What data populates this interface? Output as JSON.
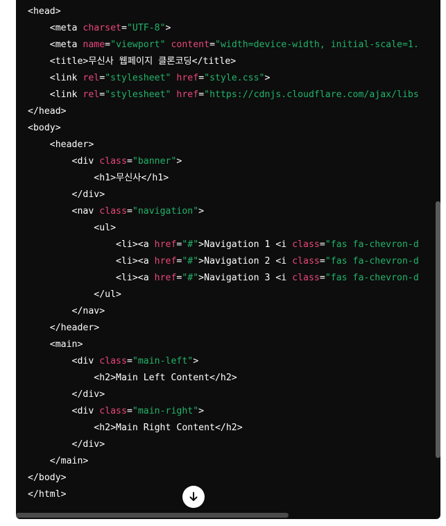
{
  "code_lines": [
    {
      "indent": "",
      "tokens": [
        {
          "t": "plain",
          "s": "<head>"
        }
      ]
    },
    {
      "indent": "    ",
      "tokens": [
        {
          "t": "plain",
          "s": "<meta "
        },
        {
          "t": "attr",
          "s": "charset"
        },
        {
          "t": "plain",
          "s": "="
        },
        {
          "t": "str",
          "s": "\"UTF-8\""
        },
        {
          "t": "plain",
          "s": ">"
        }
      ]
    },
    {
      "indent": "    ",
      "tokens": [
        {
          "t": "plain",
          "s": "<meta "
        },
        {
          "t": "attr",
          "s": "name"
        },
        {
          "t": "plain",
          "s": "="
        },
        {
          "t": "str",
          "s": "\"viewport\""
        },
        {
          "t": "plain",
          "s": " "
        },
        {
          "t": "attr",
          "s": "content"
        },
        {
          "t": "plain",
          "s": "="
        },
        {
          "t": "str",
          "s": "\"width=device-width, initial-scale=1."
        }
      ]
    },
    {
      "indent": "    ",
      "tokens": [
        {
          "t": "plain",
          "s": "<title>무신사 웹페이지 클론코딩</title>"
        }
      ]
    },
    {
      "indent": "    ",
      "tokens": [
        {
          "t": "plain",
          "s": "<link "
        },
        {
          "t": "attr",
          "s": "rel"
        },
        {
          "t": "plain",
          "s": "="
        },
        {
          "t": "str",
          "s": "\"stylesheet\""
        },
        {
          "t": "plain",
          "s": " "
        },
        {
          "t": "attr",
          "s": "href"
        },
        {
          "t": "plain",
          "s": "="
        },
        {
          "t": "str",
          "s": "\"style.css\""
        },
        {
          "t": "plain",
          "s": ">"
        }
      ]
    },
    {
      "indent": "    ",
      "tokens": [
        {
          "t": "plain",
          "s": "<link "
        },
        {
          "t": "attr",
          "s": "rel"
        },
        {
          "t": "plain",
          "s": "="
        },
        {
          "t": "str",
          "s": "\"stylesheet\""
        },
        {
          "t": "plain",
          "s": " "
        },
        {
          "t": "attr",
          "s": "href"
        },
        {
          "t": "plain",
          "s": "="
        },
        {
          "t": "str",
          "s": "\"https://cdnjs.cloudflare.com/ajax/libs"
        }
      ]
    },
    {
      "indent": "",
      "tokens": [
        {
          "t": "plain",
          "s": "</head>"
        }
      ]
    },
    {
      "indent": "",
      "tokens": [
        {
          "t": "plain",
          "s": "<body>"
        }
      ]
    },
    {
      "indent": "    ",
      "tokens": [
        {
          "t": "plain",
          "s": "<header>"
        }
      ]
    },
    {
      "indent": "        ",
      "tokens": [
        {
          "t": "plain",
          "s": "<div "
        },
        {
          "t": "attr",
          "s": "class"
        },
        {
          "t": "plain",
          "s": "="
        },
        {
          "t": "str",
          "s": "\"banner\""
        },
        {
          "t": "plain",
          "s": ">"
        }
      ]
    },
    {
      "indent": "            ",
      "tokens": [
        {
          "t": "plain",
          "s": "<h1>무신사</h1>"
        }
      ]
    },
    {
      "indent": "        ",
      "tokens": [
        {
          "t": "plain",
          "s": "</div>"
        }
      ]
    },
    {
      "indent": "        ",
      "tokens": [
        {
          "t": "plain",
          "s": "<nav "
        },
        {
          "t": "attr",
          "s": "class"
        },
        {
          "t": "plain",
          "s": "="
        },
        {
          "t": "str",
          "s": "\"navigation\""
        },
        {
          "t": "plain",
          "s": ">"
        }
      ]
    },
    {
      "indent": "            ",
      "tokens": [
        {
          "t": "plain",
          "s": "<ul>"
        }
      ]
    },
    {
      "indent": "                ",
      "tokens": [
        {
          "t": "plain",
          "s": "<li><a "
        },
        {
          "t": "attr",
          "s": "href"
        },
        {
          "t": "plain",
          "s": "="
        },
        {
          "t": "str",
          "s": "\"#\""
        },
        {
          "t": "plain",
          "s": ">Navigation 1 <i "
        },
        {
          "t": "attr",
          "s": "class"
        },
        {
          "t": "plain",
          "s": "="
        },
        {
          "t": "str",
          "s": "\"fas fa-chevron-d"
        }
      ]
    },
    {
      "indent": "                ",
      "tokens": [
        {
          "t": "plain",
          "s": "<li><a "
        },
        {
          "t": "attr",
          "s": "href"
        },
        {
          "t": "plain",
          "s": "="
        },
        {
          "t": "str",
          "s": "\"#\""
        },
        {
          "t": "plain",
          "s": ">Navigation 2 <i "
        },
        {
          "t": "attr",
          "s": "class"
        },
        {
          "t": "plain",
          "s": "="
        },
        {
          "t": "str",
          "s": "\"fas fa-chevron-d"
        }
      ]
    },
    {
      "indent": "                ",
      "tokens": [
        {
          "t": "plain",
          "s": "<li><a "
        },
        {
          "t": "attr",
          "s": "href"
        },
        {
          "t": "plain",
          "s": "="
        },
        {
          "t": "str",
          "s": "\"#\""
        },
        {
          "t": "plain",
          "s": ">Navigation 3 <i "
        },
        {
          "t": "attr",
          "s": "class"
        },
        {
          "t": "plain",
          "s": "="
        },
        {
          "t": "str",
          "s": "\"fas fa-chevron-d"
        }
      ]
    },
    {
      "indent": "            ",
      "tokens": [
        {
          "t": "plain",
          "s": "</ul>"
        }
      ]
    },
    {
      "indent": "        ",
      "tokens": [
        {
          "t": "plain",
          "s": "</nav>"
        }
      ]
    },
    {
      "indent": "    ",
      "tokens": [
        {
          "t": "plain",
          "s": "</header>"
        }
      ]
    },
    {
      "indent": "    ",
      "tokens": [
        {
          "t": "plain",
          "s": "<main>"
        }
      ]
    },
    {
      "indent": "        ",
      "tokens": [
        {
          "t": "plain",
          "s": "<div "
        },
        {
          "t": "attr",
          "s": "class"
        },
        {
          "t": "plain",
          "s": "="
        },
        {
          "t": "str",
          "s": "\"main-left\""
        },
        {
          "t": "plain",
          "s": ">"
        }
      ]
    },
    {
      "indent": "            ",
      "tokens": [
        {
          "t": "plain",
          "s": "<h2>Main Left Content</h2>"
        }
      ]
    },
    {
      "indent": "        ",
      "tokens": [
        {
          "t": "plain",
          "s": "</div>"
        }
      ]
    },
    {
      "indent": "        ",
      "tokens": [
        {
          "t": "plain",
          "s": "<div "
        },
        {
          "t": "attr",
          "s": "class"
        },
        {
          "t": "plain",
          "s": "="
        },
        {
          "t": "str",
          "s": "\"main-right\""
        },
        {
          "t": "plain",
          "s": ">"
        }
      ]
    },
    {
      "indent": "            ",
      "tokens": [
        {
          "t": "plain",
          "s": "<h2>Main Right Content</h2>"
        }
      ]
    },
    {
      "indent": "        ",
      "tokens": [
        {
          "t": "plain",
          "s": "</div>"
        }
      ]
    },
    {
      "indent": "    ",
      "tokens": [
        {
          "t": "plain",
          "s": "</main>"
        }
      ]
    },
    {
      "indent": "",
      "tokens": [
        {
          "t": "plain",
          "s": "</body>"
        }
      ]
    },
    {
      "indent": "",
      "tokens": [
        {
          "t": "plain",
          "s": "</html>"
        }
      ]
    }
  ],
  "colors": {
    "background": "#0d0d0d",
    "text": "#ffffff",
    "attribute": "#e9477a",
    "string": "#22b36a"
  },
  "scroll_button": {
    "icon": "arrow-down-icon"
  }
}
